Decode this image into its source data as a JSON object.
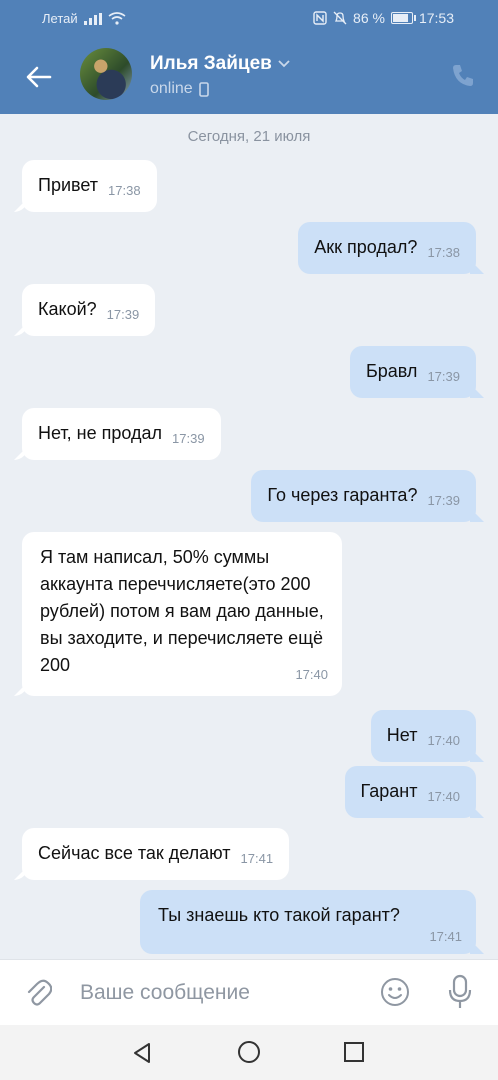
{
  "status_bar": {
    "carrier": "Летай",
    "battery_text": "86 %",
    "battery_level": 0.86,
    "time": "17:53",
    "icons": [
      "signal-icon",
      "wifi-icon",
      "nfc-icon",
      "mute-icon",
      "battery-icon"
    ]
  },
  "header": {
    "contact_name": "Илья Зайцев",
    "status": "online",
    "icons": [
      "back-arrow-icon",
      "chevron-down-icon",
      "mobile-icon",
      "phone-icon"
    ]
  },
  "chat": {
    "date_divider": "Сегодня, 21 июля",
    "messages": [
      {
        "direction": "in",
        "text": "Привет",
        "time": "17:38"
      },
      {
        "direction": "out",
        "text": "Акк продал?",
        "time": "17:38"
      },
      {
        "direction": "in",
        "text": "Какой?",
        "time": "17:39"
      },
      {
        "direction": "out",
        "text": "Бравл",
        "time": "17:39"
      },
      {
        "direction": "in",
        "text": "Нет, не продал",
        "time": "17:39"
      },
      {
        "direction": "out",
        "text": "Го через гаранта?",
        "time": "17:39"
      },
      {
        "direction": "in",
        "text": "Я там написал, 50% суммы аккаунта переччисляете(это 200 рублей) потом я вам даю данные, вы заходите, и перечисляете ещё 200",
        "time": "17:40"
      },
      {
        "direction": "out",
        "text": "Нет",
        "time": "17:40"
      },
      {
        "direction": "out",
        "text": "Гарант",
        "time": "17:40"
      },
      {
        "direction": "in",
        "text": "Сейчас все так делают",
        "time": "17:41"
      },
      {
        "direction": "out",
        "text": "Ты знаешь кто такой гарант?",
        "time": "17:41"
      }
    ]
  },
  "composer": {
    "placeholder": "Ваше сообщение",
    "icons": [
      "attach-icon",
      "emoji-icon",
      "mic-icon"
    ]
  },
  "navigation": {
    "icons": [
      "nav-back-icon",
      "nav-home-icon",
      "nav-recent-icon"
    ]
  },
  "colors": {
    "header": "#5181b8",
    "chat_background": "#ebeff4",
    "incoming_bubble": "#ffffff",
    "outgoing_bubble": "#cce0f7"
  }
}
